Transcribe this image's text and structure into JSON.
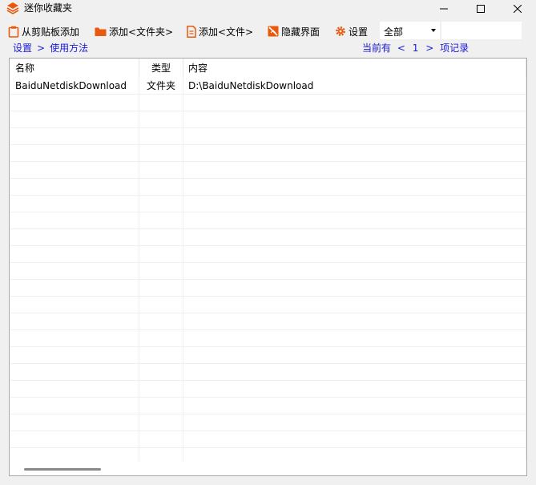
{
  "window": {
    "title": "迷你收藏夹",
    "icon": "layers-icon"
  },
  "toolbar": {
    "paste_add": "从剪贴板添加",
    "add_folder": "添加<文件夹>",
    "add_file": "添加<文件>",
    "hide_ui": "隐藏界面",
    "settings": "设置",
    "filter_value": "全部",
    "search_value": ""
  },
  "nav": {
    "settings": "设置",
    "separator": ">",
    "usage": "使用方法",
    "count_prefix": "当前有",
    "count_left": "<",
    "count": "1",
    "count_right": ">",
    "count_suffix": "项记录"
  },
  "table": {
    "columns": [
      "名称",
      "类型",
      "内容"
    ],
    "rows": [
      {
        "name": "BaiduNetdiskDownload",
        "type": "文件夹",
        "content": "D:\\BaiduNetdiskDownload"
      }
    ]
  },
  "colors": {
    "accent_orange": "#e8590c",
    "link_blue": "#1a1ad8"
  }
}
